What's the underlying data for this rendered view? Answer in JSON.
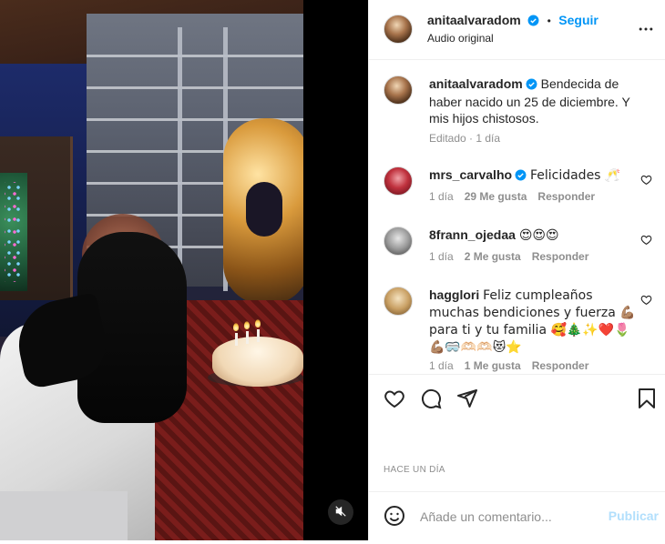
{
  "media": {
    "mute_icon": "speaker-muted-icon"
  },
  "header": {
    "username": "anitaalvaradom",
    "separator": "•",
    "follow_label": "Seguir",
    "subtitle": "Audio original",
    "more_icon": "more-horizontal-icon"
  },
  "caption": {
    "username": "anitaalvaradom",
    "text": "Bendecida de haber nacido un 25 de diciembre. Y mis hijos chistosos.",
    "meta": "Editado · 1 día"
  },
  "comments": [
    {
      "username": "mrs_carvalho",
      "verified": true,
      "text": "Felicidades 🥂",
      "time": "1 día",
      "likes": "29 Me gusta",
      "reply": "Responder"
    },
    {
      "username": "8frann_ojedaa",
      "verified": false,
      "text": "😍😍😍",
      "time": "1 día",
      "likes": "2 Me gusta",
      "reply": "Responder"
    },
    {
      "username": "hagglori",
      "verified": false,
      "text": "Feliz cumpleaños muchas bendiciones y fuerza 💪🏽 para ti y tu familia 🥰🎄✨❤️🌷💪🏽🥽🫶🏻🫶🏻😻⭐",
      "time": "1 día",
      "likes": "1 Me gusta",
      "reply": "Responder"
    }
  ],
  "actions": {
    "like_icon": "heart-icon",
    "comment_icon": "comment-icon",
    "share_icon": "share-icon",
    "save_icon": "bookmark-icon"
  },
  "date_label": "Hace un día",
  "add_comment": {
    "emoji_icon": "emoji-icon",
    "placeholder": "Añade un comentario...",
    "post_label": "Publicar"
  },
  "colors": {
    "accent": "#0095f6",
    "verified": "#0095f6",
    "post_disabled": "#b2dffc",
    "muted_text": "#8e8e8e"
  }
}
